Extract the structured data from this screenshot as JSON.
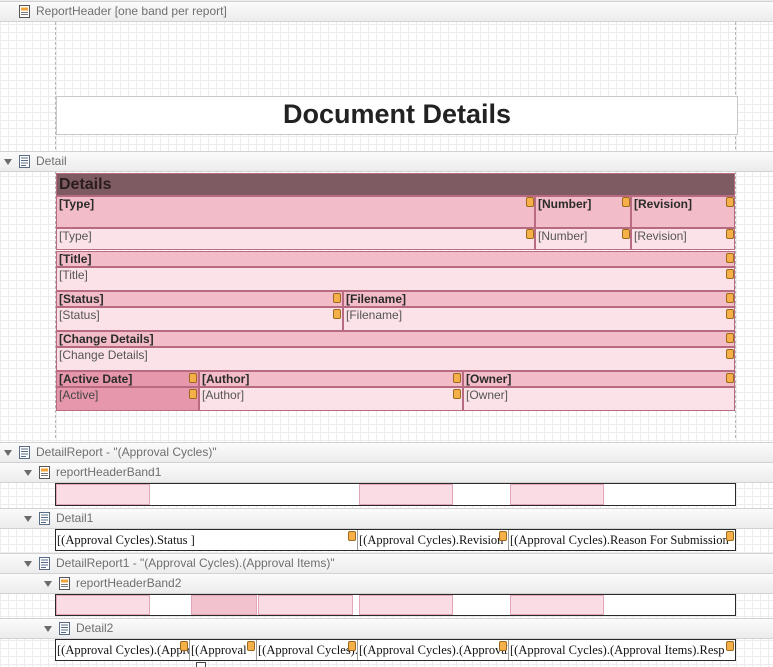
{
  "bands": {
    "report_header": "ReportHeader [one band per report]",
    "detail": "Detail",
    "detail_report": "DetailReport - \"(Approval Cycles)\"",
    "report_header_band1": "reportHeaderBand1",
    "detail1": "Detail1",
    "detail_report1": "DetailReport1 - \"(Approval Cycles).(Approval Items)\"",
    "report_header_band2": "reportHeaderBand2",
    "detail2": "Detail2"
  },
  "title": "Document Details",
  "detail": {
    "header": "Details",
    "type_caption": "[Type]",
    "number_caption": "[Number]",
    "revision_caption": "[Revision]",
    "type_value": "[Type]",
    "number_value": "[Number]",
    "revision_value": "[Revision]",
    "title_caption": "[Title]",
    "title_value": "[Title]",
    "status_caption": "[Status]",
    "filename_caption": "[Filename]",
    "status_value": "[Status]",
    "filename_value": "[Filename]",
    "change_caption": "[Change Details]",
    "change_value": "[Change Details]",
    "active_caption": "[Active Date]",
    "author_caption": "[Author]",
    "owner_caption": "[Owner]",
    "active_value": "[Active]",
    "author_value": "[Author]",
    "owner_value": "[Owner]"
  },
  "detail1_cells": [
    "[(Approval Cycles).Status    ]",
    "[(Approval Cycles).Revision",
    "[(Approval Cycles).Reason For Submission"
  ],
  "detail2_cells": [
    "[(Approval Cycles).(Approval",
    "[(Approval",
    "[(Approval Cycles).",
    "[(Approval Cycles).(Approval",
    "[(Approval Cycles).(Approval Items).Resp"
  ],
  "colors": {
    "caption_fill": "#f2bcc9",
    "value_fill": "#fbe2e8",
    "header_fill": "#7e5b63",
    "tag": "#f6b04a"
  },
  "icons": [
    "collapse-triangle-icon",
    "report-band-icon",
    "detail-band-icon",
    "smart-tag-icon"
  ]
}
